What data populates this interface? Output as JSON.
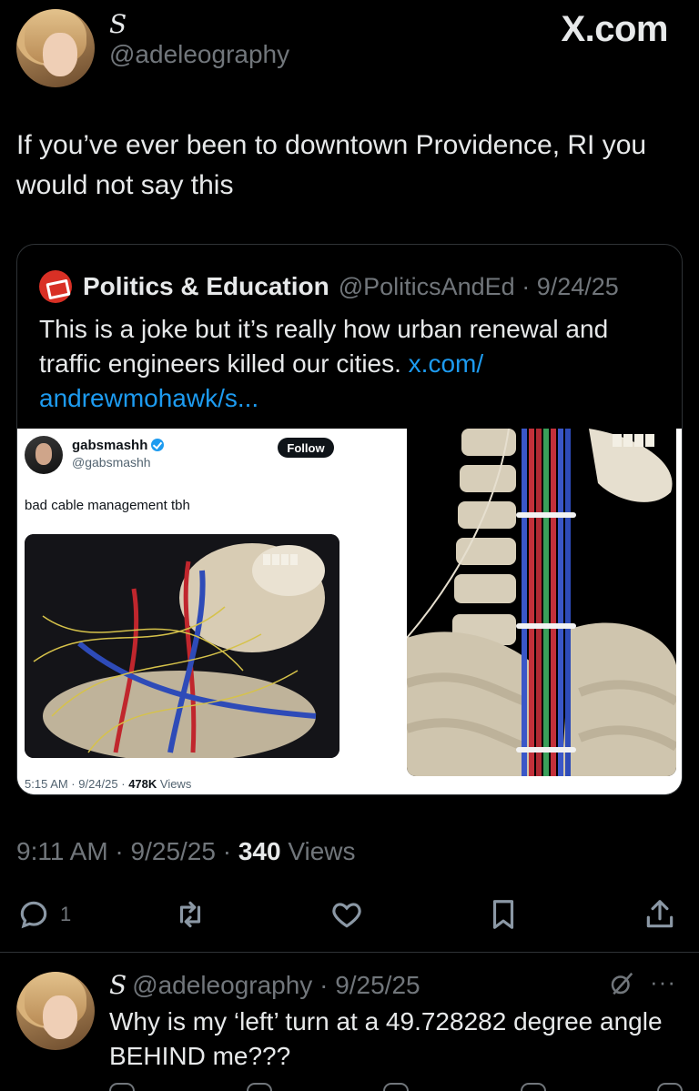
{
  "header": {
    "display_name": "S",
    "handle": "@adeleography",
    "watermark": "X.com"
  },
  "tweet": {
    "text": "If you’ve ever been to downtown Providence, RI you would not say this",
    "timestamp": "9:11 AM · 9/25/25 · ",
    "views_count": "340",
    "views_label": " Views"
  },
  "quote": {
    "name": "Politics & Education",
    "meta": "@PoliticsAndEd · 9/24/25",
    "text": "This is a joke but it’s really how urban renewal and traffic engineers killed our cities. ",
    "link": "x.com/\nandrewmohawk/s...",
    "embedded_post": {
      "name": "gabsmashh",
      "handle": "@gabsmashh",
      "follow_label": "Follow",
      "text": "bad cable management tbh",
      "footer_time": "5:15 AM · 9/24/25 · ",
      "footer_views_count": "478K",
      "footer_views_label": " Views"
    }
  },
  "actions": {
    "reply_count": "1",
    "icons": [
      "reply-icon",
      "retweet-icon",
      "like-icon",
      "bookmark-icon",
      "share-icon"
    ]
  },
  "reply": {
    "display_name": "S",
    "meta": "@adeleography · 9/25/25",
    "text": "Why is my ‘left’ turn at a 49.728282 degree angle BEHIND me???",
    "more": "···"
  },
  "colors": {
    "background": "#000000",
    "text": "#e7e9ea",
    "muted": "#71767b",
    "link": "#1d9bf0",
    "border": "#2f3336"
  }
}
